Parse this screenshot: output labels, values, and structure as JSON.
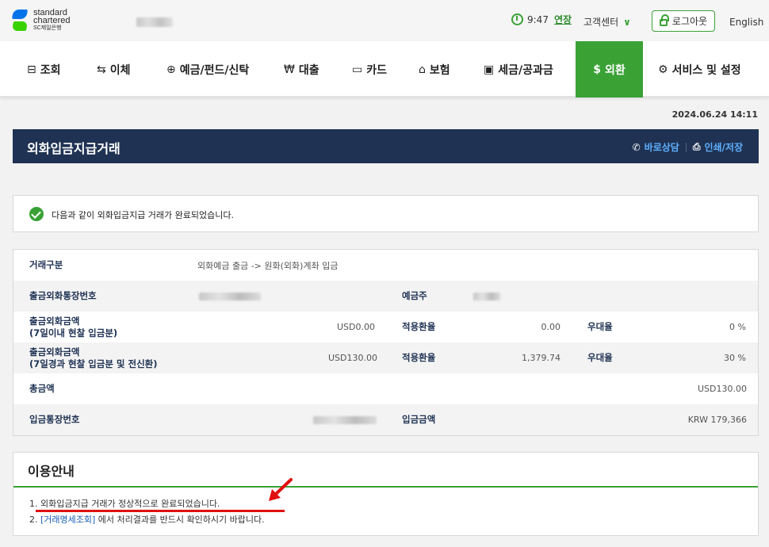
{
  "header": {
    "logo": {
      "line1": "standard",
      "line2": "chartered",
      "line3": "SC제일은행"
    },
    "timer": "9:47",
    "extend": "연장",
    "customer_center": "고객센터",
    "logout": "로그아웃",
    "language": "English"
  },
  "nav": {
    "items": [
      {
        "label": "조회",
        "icon": "inquiry-icon"
      },
      {
        "label": "이체",
        "icon": "transfer-icon"
      },
      {
        "label": "예금/펀드/신탁",
        "icon": "deposit-icon"
      },
      {
        "label": "대출",
        "icon": "loan-icon"
      },
      {
        "label": "카드",
        "icon": "card-icon"
      },
      {
        "label": "보험",
        "icon": "insurance-icon"
      },
      {
        "label": "세금/공과금",
        "icon": "tax-icon"
      },
      {
        "label": "외환",
        "icon": "dollar-icon"
      },
      {
        "label": "서비스 및 설정",
        "icon": "gear-icon"
      }
    ],
    "active_index": 7
  },
  "datetime": "2024.06.24 14:11",
  "page": {
    "title": "외화입금지급거래",
    "consult": "바로상담",
    "print": "인쇄/저장"
  },
  "message": "다음과 같이 외화입금지급 거래가 완료되었습니다.",
  "details": {
    "type_label": "거래구분",
    "type_value": "외화예금 출금 -> 원화(외화)계좌 입금",
    "account_label": "출금외화통장번호",
    "holder_label": "예금주",
    "amt1_label_1": "출금외화금액",
    "amt1_label_2": "(7일이내 현찰 입금분)",
    "amt1_value": "USD0.00",
    "rate1_label": "적용환율",
    "rate1_value": "0.00",
    "pref1_label": "우대율",
    "pref1_value": "0 %",
    "amt2_label_1": "출금외화금액",
    "amt2_label_2": "(7일경과 현찰 입금분 및 전신환)",
    "amt2_value": "USD130.00",
    "rate2_label": "적용환율",
    "rate2_value": "1,379.74",
    "pref2_label": "우대율",
    "pref2_value": "30 %",
    "total_label": "총금액",
    "total_value": "USD130.00",
    "deposit_account_label": "입금통장번호",
    "deposit_amount_label": "입금금액",
    "deposit_amount_value": "KRW 179,366"
  },
  "info": {
    "title": "이용안내",
    "item1": "1.  외화입금지급 거래가 정상적으로 완료되었습니다.",
    "item2_prefix": "2.  ",
    "item2_link": "[거래명세조회]",
    "item2_suffix": " 에서 처리결과를 반드시 확인하시기 바랍니다."
  },
  "colors": {
    "brand_green": "#3aa235",
    "navy": "#1f3253",
    "annotation_red": "#e01010"
  }
}
